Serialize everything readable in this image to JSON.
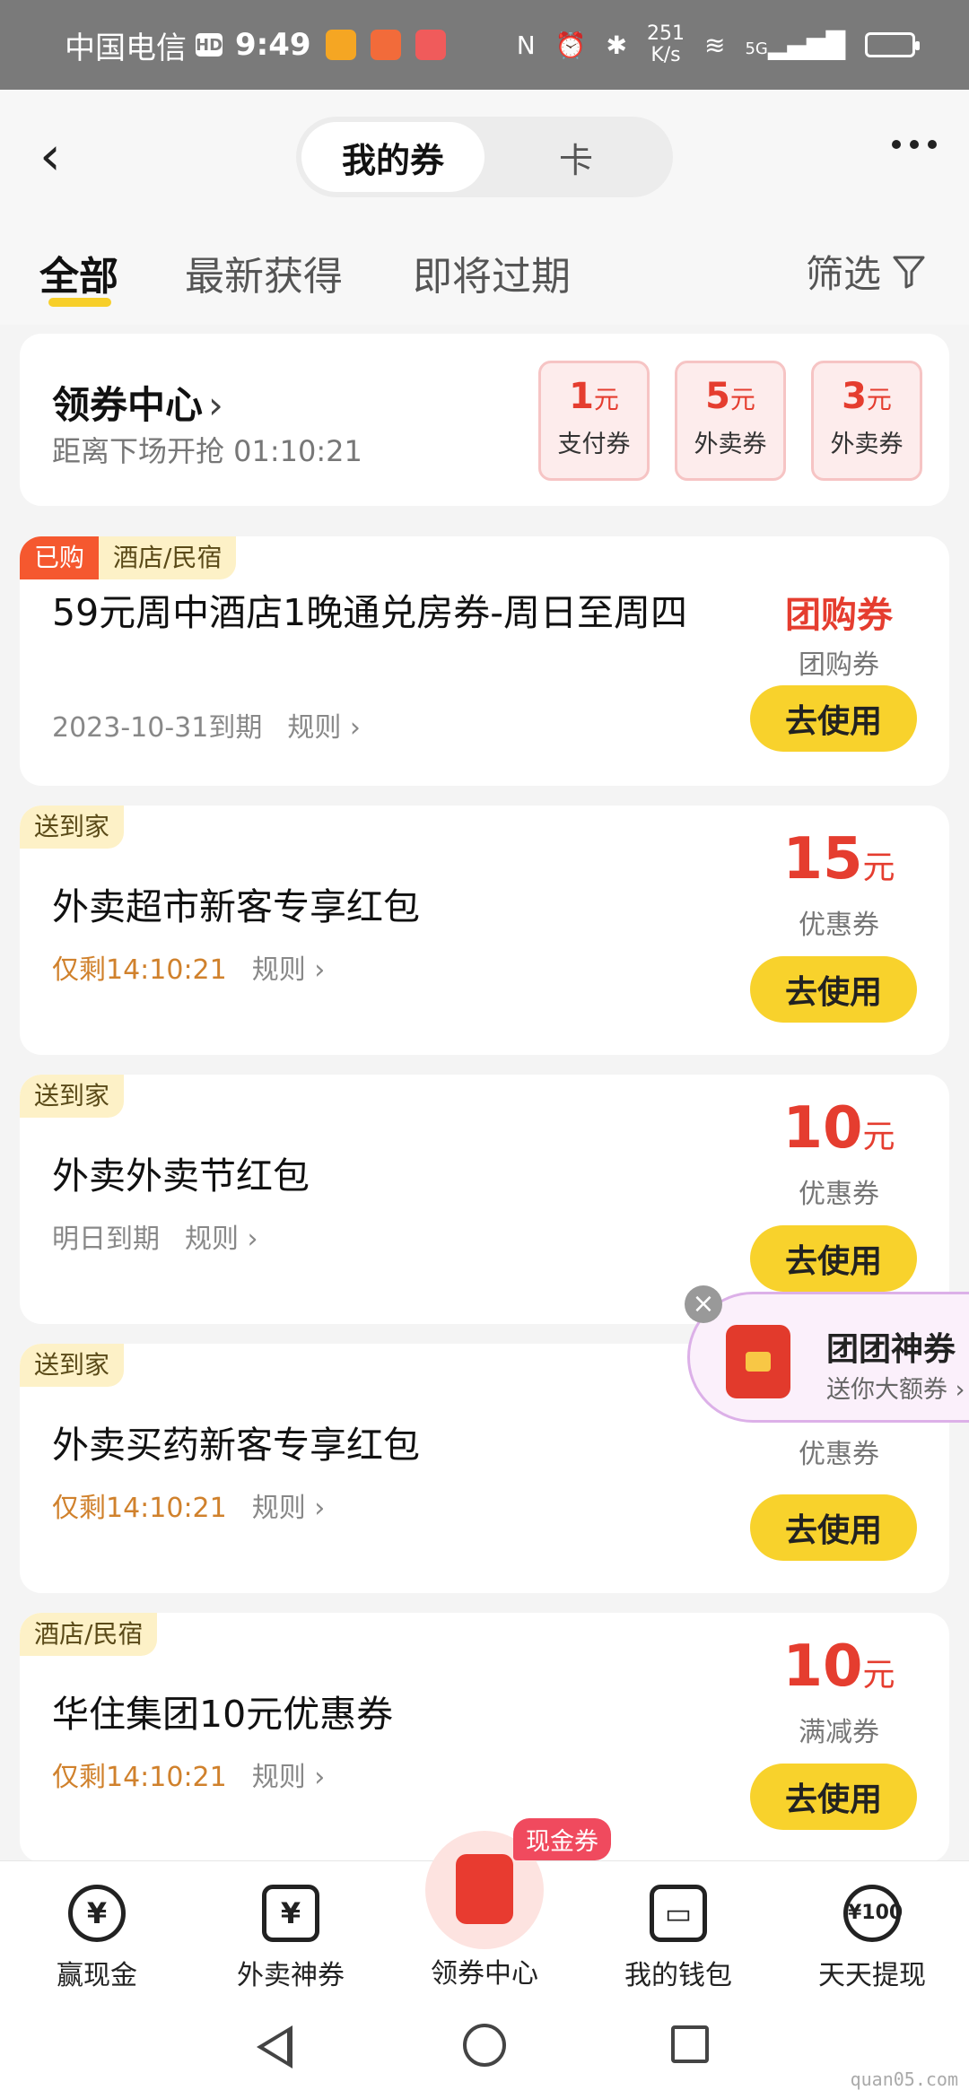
{
  "status_bar": {
    "carrier": "中国电信",
    "hd": "HD",
    "time": "9:49",
    "speed_value": "251",
    "speed_unit": "K/s",
    "network": "5G"
  },
  "header": {
    "tabs": [
      "我的券",
      "卡"
    ],
    "active_tab": 0
  },
  "filters": {
    "tabs": [
      "全部",
      "最新获得",
      "即将过期"
    ],
    "filter_label": "筛选"
  },
  "coupon_center": {
    "title": "领券中心",
    "countdown_label": "距离下场开抢 01:10:21",
    "mini_coupons": [
      {
        "amount": "1",
        "unit": "元",
        "label": "支付券"
      },
      {
        "amount": "5",
        "unit": "元",
        "label": "外卖券"
      },
      {
        "amount": "3",
        "unit": "元",
        "label": "外卖券"
      }
    ]
  },
  "coupons": [
    {
      "tag1": "已购",
      "tag2": "酒店/民宿",
      "title": "59元周中酒店1晚通兑房券-周日至周四",
      "meta": "2023-10-31到期",
      "rule": "规则 ›",
      "value": "团购券",
      "sub": "团购券",
      "button": "去使用"
    },
    {
      "tag1": "送到家",
      "title": "外卖超市新客专享红包",
      "meta": "仅剩14:10:21",
      "rule": "规则 ›",
      "amount": "15",
      "unit": "元",
      "sub": "优惠券",
      "button": "去使用"
    },
    {
      "tag1": "送到家",
      "title": "外卖外卖节红包",
      "meta": "明日到期",
      "rule": "规则 ›",
      "amount": "10",
      "unit": "元",
      "sub": "优惠券",
      "button": "去使用"
    },
    {
      "tag1": "送到家",
      "title": "外卖买药新客专享红包",
      "meta": "仅剩14:10:21",
      "rule": "规则 ›",
      "sub": "优惠券",
      "button": "去使用"
    },
    {
      "tag1": "酒店/民宿",
      "title": "华住集团10元优惠券",
      "meta": "仅剩14:10:21",
      "rule": "规则 ›",
      "amount": "10",
      "unit": "元",
      "sub": "满减券",
      "button": "去使用"
    }
  ],
  "promo": {
    "title": "团团神券",
    "subtitle": "送你大额券 ›"
  },
  "bottom_nav": {
    "items": [
      "赢现金",
      "外卖神券",
      "领券中心",
      "我的钱包",
      "天天提现"
    ],
    "badge": "现金券",
    "icons": [
      "yen-circle-icon",
      "yen-bag-icon",
      "red-envelope-icon",
      "wallet-icon",
      "hundred-coin-icon"
    ]
  },
  "watermark": "quan05.com",
  "colors": {
    "accent_yellow": "#f8d22c",
    "price_red": "#e53d2f",
    "status_gray": "#7a7a7a",
    "tag_orange": "#f5582f"
  }
}
